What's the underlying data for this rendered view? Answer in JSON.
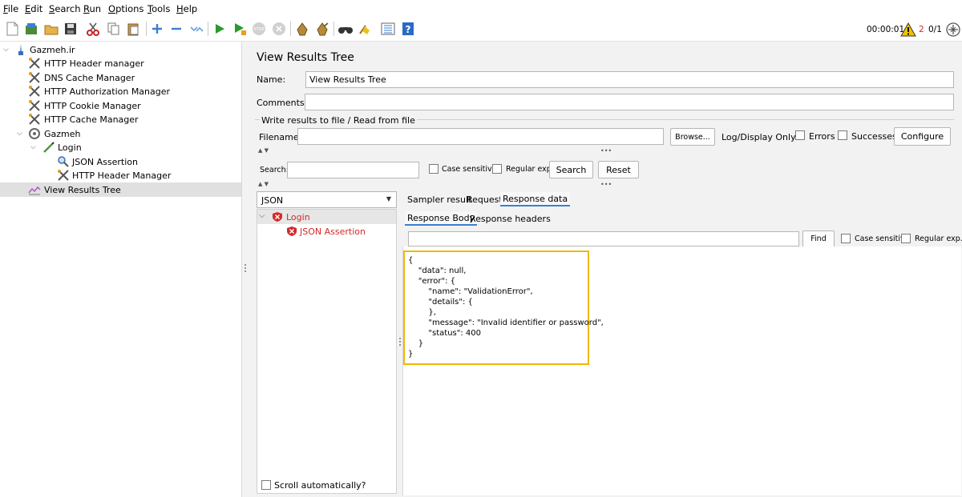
{
  "menu": [
    "File",
    "Edit",
    "Search",
    "Run",
    "Options",
    "Tools",
    "Help"
  ],
  "toolbar_icons": [
    "new-icon",
    "templates-icon",
    "open-icon",
    "save-icon",
    "cut-icon",
    "copy-icon",
    "paste-icon",
    "expand-icon",
    "collapse-icon",
    "toggle-icon",
    "start-icon",
    "start-no-pauses-icon",
    "stop-icon",
    "shutdown-icon",
    "clear-icon",
    "clear-all-icon",
    "search-icon",
    "reset-search-icon",
    "function-helper-icon",
    "help-icon"
  ],
  "status": {
    "elapsed": "00:00:01",
    "warnings": "2",
    "threads": "0/1"
  },
  "tree": {
    "items": [
      {
        "label": "Gazmeh.ir",
        "icon": "test-plan-icon"
      },
      {
        "label": "HTTP Header manager",
        "icon": "config-tools-icon"
      },
      {
        "label": "DNS Cache Manager",
        "icon": "config-tools-icon"
      },
      {
        "label": "HTTP Authorization Manager",
        "icon": "config-tools-icon"
      },
      {
        "label": "HTTP Cookie Manager",
        "icon": "config-tools-icon"
      },
      {
        "label": "HTTP Cache Manager",
        "icon": "config-tools-icon"
      },
      {
        "label": "Gazmeh",
        "icon": "thread-group-icon"
      },
      {
        "label": "Login",
        "icon": "sampler-pen-icon"
      },
      {
        "label": "JSON Assertion",
        "icon": "magnifier-icon"
      },
      {
        "label": "HTTP Header Manager",
        "icon": "config-tools-icon"
      },
      {
        "label": "View Results Tree",
        "icon": "listener-graph-icon"
      }
    ]
  },
  "panel": {
    "title": "View Results Tree",
    "name_label": "Name:",
    "name_value": "View Results Tree",
    "comments_label": "Comments:",
    "comments_value": "",
    "file_section": "Write results to file / Read from file",
    "filename_label": "Filename",
    "filename_value": "",
    "browse": "Browse...",
    "log_display": "Log/Display Only:",
    "errors": "Errors",
    "successes": "Successes",
    "configure": "Configure",
    "search_label": "Search:",
    "case_sensitive": "Case sensitive",
    "regular_exp": "Regular exp.",
    "search_btn": "Search",
    "reset_btn": "Reset"
  },
  "results": {
    "renderer": "JSON",
    "samples": [
      {
        "label": "Login",
        "status": "error"
      },
      {
        "label": "JSON Assertion",
        "status": "error"
      }
    ],
    "scroll_auto": "Scroll automatically?"
  },
  "tabs": {
    "top": [
      "Sampler result",
      "Request",
      "Response data"
    ],
    "active_top": "Response data",
    "sub": [
      "Response Body",
      "Response headers"
    ],
    "active_sub": "Response Body"
  },
  "find": {
    "value": "",
    "button": "Find",
    "case_sensitive": "Case sensitive",
    "regular_exp": "Regular exp."
  },
  "response_body": [
    "{",
    "    \"data\": null,",
    "    \"error\": {",
    "        \"name\": \"ValidationError\",",
    "        \"details\": {",
    "        },",
    "        \"message\": \"Invalid identifier or password\",",
    "        \"status\": 400",
    "    }",
    "}"
  ],
  "colors": {
    "accent": "#3b7fd2",
    "error": "#d62828",
    "highlight": "#f2b705",
    "selected": "#e0e0e0"
  }
}
